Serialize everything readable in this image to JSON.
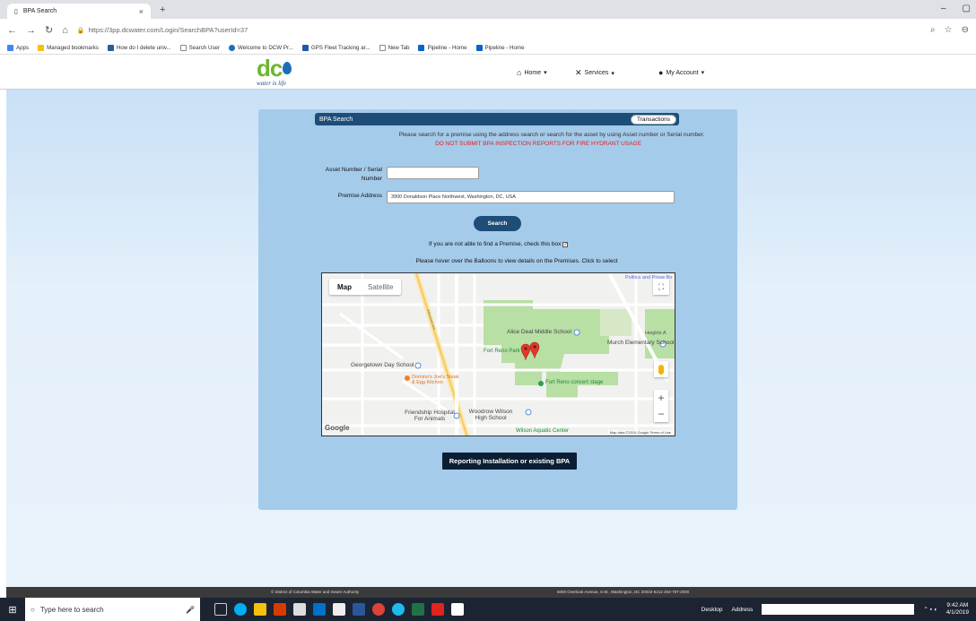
{
  "browser": {
    "tab_title": "BPA Search",
    "tab_close": "×",
    "new_tab": "+",
    "url": "https://3pp.dcwater.com/Login/SearchBPA?userId=37",
    "bookmarks": [
      "Apps",
      "Managed bookmarks",
      "How do I delete univ...",
      "Search User",
      "Welcome to DCW Pr...",
      "GPS Fleet Tracking ar...",
      "New Tab",
      "Pipeline - Home",
      "Pipeline - Home"
    ]
  },
  "site": {
    "logo_text": "dc",
    "logo_tagline": "water is life",
    "nav": {
      "home": "Home",
      "services": "Services",
      "account": "My Account"
    }
  },
  "form": {
    "panel_title": "BPA Search",
    "transactions_label": "Transactions",
    "intro": "Please search for a premise using the address search or search for the asset by using Asset number or Serial number.",
    "warning": "DO NOT SUBMIT BPA INSPECTION REPORTS FOR FIRE HYDRANT USAGE",
    "asset_label": "Asset Number / Serial Number",
    "asset_value": "",
    "premise_label": "Premise Address",
    "premise_value": "3900 Donaldson Place Northwest, Washington, DC, USA",
    "search_label": "Search",
    "checkbox_text": "If you are not able to find a Premise, check this box",
    "hover_hint": "Please hover over the Balloons to view details on the Premises. Click to select",
    "report_label": "Reporting Installation or existing BPA"
  },
  "map": {
    "type_map": "Map",
    "type_satellite": "Satellite",
    "zoom_in": "+",
    "zoom_out": "−",
    "google": "Google",
    "attribution": "Map data ©2019 Google   Terms of Use",
    "labels": {
      "alice_deal": "Alice Deal Middle School",
      "fort_reno_park": "Fort Reno Park",
      "murch": "Murch Elementary School",
      "georgetown_day": "Georgetown Day School",
      "concert": "Fort Reno concert stage",
      "domino": "Domino's Joe's Steak & Egg Kitchen",
      "friendship": "Friendship Hospital For Animals",
      "woodrow": "Woodrow Wilson High School",
      "aquatic": "Wilson Aquatic Center",
      "politics": "Politics and Prose Bo",
      "heights": "Heights A",
      "wisconsin": "Wisconsin Ave"
    }
  },
  "footer": {
    "left": "© District of Columbia Water and Sewer Authority",
    "right": "5000 Overlook Avenue, S.W., Washington, DC 20032-5212 202-787-2000"
  },
  "taskbar": {
    "search_placeholder": "Type here to search",
    "desktop": "Desktop",
    "address": "Address",
    "time": "9:42 AM",
    "date": "4/1/2019"
  }
}
